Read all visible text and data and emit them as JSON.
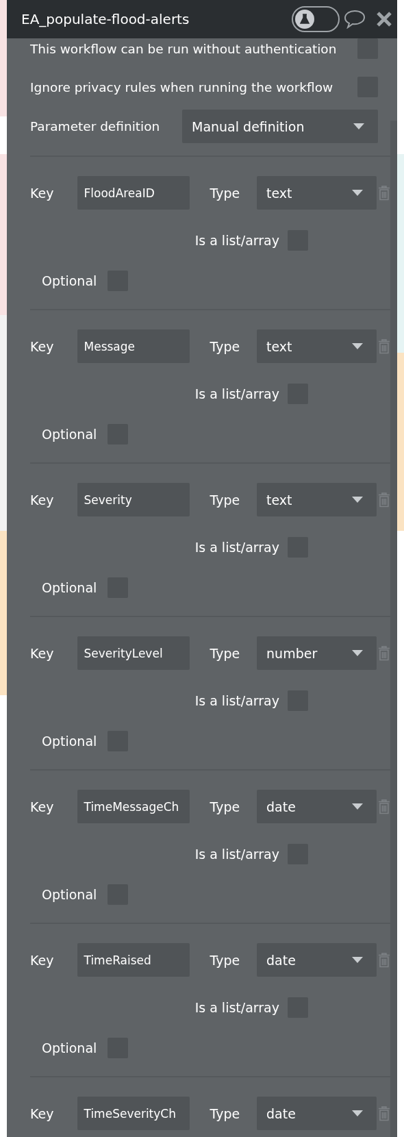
{
  "header": {
    "title": "EA_populate-flood-alerts",
    "test_toggle": {
      "on": false
    }
  },
  "options": [
    {
      "label": "This workflow can be run without authentication",
      "checked": false
    },
    {
      "label": "Ignore privacy rules when running the workflow",
      "checked": false
    }
  ],
  "parameter_definition": {
    "label": "Parameter definition",
    "value": "Manual definition"
  },
  "parameters": [
    {
      "key_label": "Key",
      "key": "FloodAreaID",
      "type_label": "Type",
      "type": "text",
      "list_label": "Is a list/array",
      "is_list": false,
      "optional_label": "Optional",
      "optional": false
    },
    {
      "key_label": "Key",
      "key": "Message",
      "type_label": "Type",
      "type": "text",
      "list_label": "Is a list/array",
      "is_list": false,
      "optional_label": "Optional",
      "optional": false
    },
    {
      "key_label": "Key",
      "key": "Severity",
      "type_label": "Type",
      "type": "text",
      "list_label": "Is a list/array",
      "is_list": false,
      "optional_label": "Optional",
      "optional": false
    },
    {
      "key_label": "Key",
      "key": "SeverityLevel",
      "type_label": "Type",
      "type": "number",
      "list_label": "Is a list/array",
      "is_list": false,
      "optional_label": "Optional",
      "optional": false
    },
    {
      "key_label": "Key",
      "key": "TimeMessageCh",
      "type_label": "Type",
      "type": "date",
      "list_label": "Is a list/array",
      "is_list": false,
      "optional_label": "Optional",
      "optional": false
    },
    {
      "key_label": "Key",
      "key": "TimeRaised",
      "type_label": "Type",
      "type": "date",
      "list_label": "Is a list/array",
      "is_list": false,
      "optional_label": "Optional",
      "optional": false
    },
    {
      "key_label": "Key",
      "key": "TimeSeverityCh",
      "type_label": "Type",
      "type": "date"
    }
  ]
}
